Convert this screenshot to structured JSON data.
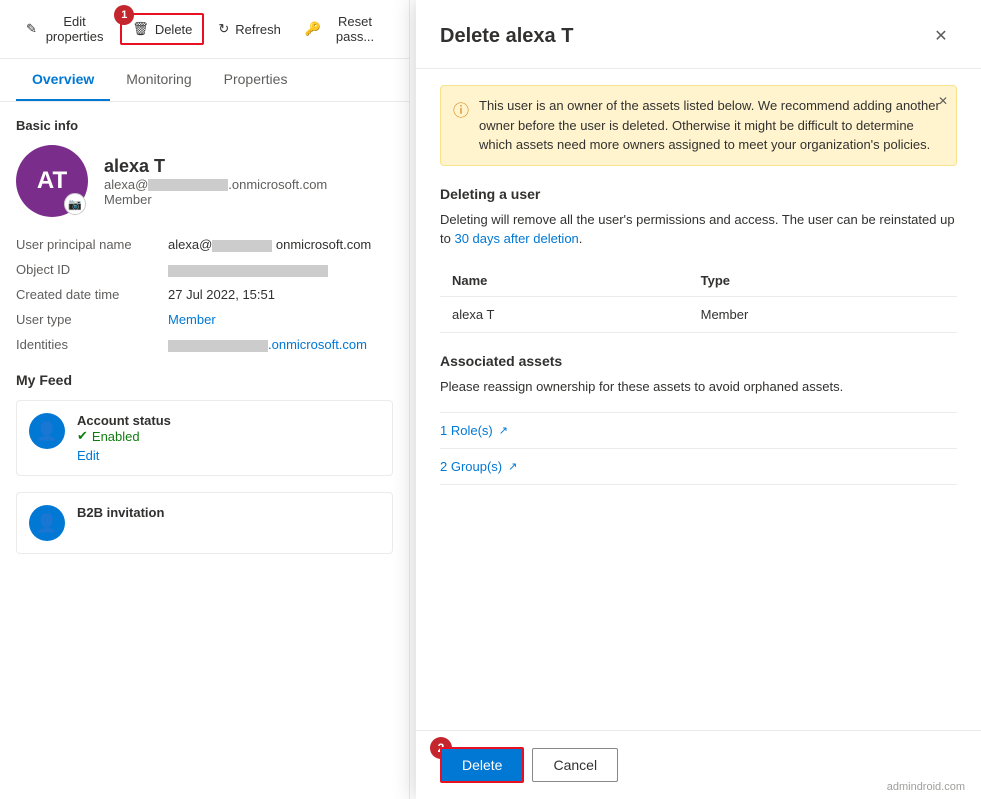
{
  "left": {
    "toolbar": {
      "edit_properties": "Edit properties",
      "delete": "Delete",
      "refresh": "Refresh",
      "reset_password": "Reset pass..."
    },
    "tabs": [
      "Overview",
      "Monitoring",
      "Properties"
    ],
    "active_tab": "Overview",
    "section_basic_info": "Basic info",
    "user": {
      "initials": "AT",
      "name": "alexa T",
      "email": "alexa@██████.onmicrosoft.com",
      "role": "Member"
    },
    "properties": [
      {
        "label": "User principal name",
        "value": "alexa@██████ onmicrosoft.com",
        "type": "blurred"
      },
      {
        "label": "Object ID",
        "value": "████████████████████",
        "type": "blurred"
      },
      {
        "label": "Created date time",
        "value": "27 Jul 2022, 15:51",
        "type": "text"
      },
      {
        "label": "User type",
        "value": "Member",
        "type": "link"
      },
      {
        "label": "Identities",
        "value": "██████.onmicrosoft.com",
        "type": "link"
      }
    ],
    "my_feed": "My Feed",
    "feed_items": [
      {
        "title": "Account status",
        "status": "Enabled",
        "link": "Edit"
      },
      {
        "title": "B2B invitation"
      }
    ]
  },
  "dialog": {
    "title": "Delete alexa T",
    "warning": {
      "text": "This user is an owner of the assets listed below. We recommend adding another owner before the user is deleted. Otherwise it might be difficult to determine which assets need more owners assigned to meet your organization's policies."
    },
    "section_deleting": "Deleting a user",
    "deleting_text_1": "Deleting will remove all the user's permissions and access. The user can be reinstated up to ",
    "deleting_link": "30 days after deletion",
    "deleting_text_2": ".",
    "table": {
      "headers": [
        "Name",
        "Type"
      ],
      "rows": [
        {
          "name": "alexa T",
          "type": "Member"
        }
      ]
    },
    "section_assets": "Associated assets",
    "assets_text": "Please reassign ownership for these assets to avoid orphaned assets.",
    "assets": [
      {
        "label": "1 Role(s)"
      },
      {
        "label": "2 Group(s)"
      }
    ],
    "footer": {
      "delete_label": "Delete",
      "cancel_label": "Cancel"
    }
  },
  "step_badges": {
    "step1": "1",
    "step2": "2"
  },
  "watermark": "admindroid.com"
}
